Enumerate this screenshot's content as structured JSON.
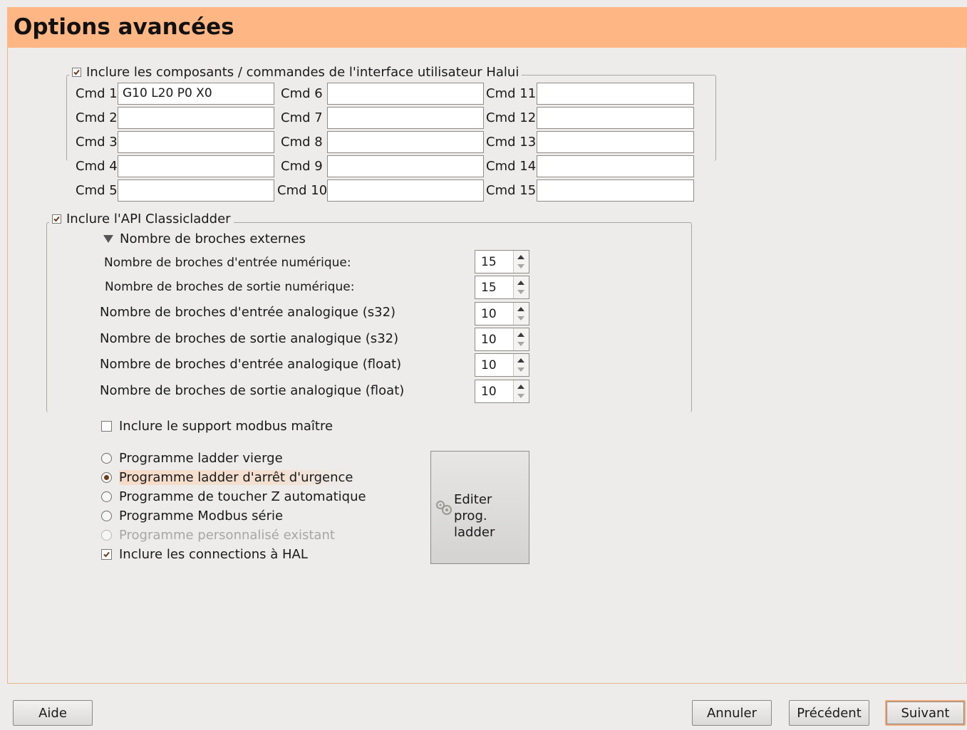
{
  "header": {
    "title": "Options avancées"
  },
  "halui": {
    "checkbox_label": "Inclure les composants / commandes de l'interface utilisateur Halui",
    "checked": true,
    "commands": [
      {
        "label": "Cmd 1",
        "value": "G10 L20 P0 X0"
      },
      {
        "label": "Cmd 2",
        "value": ""
      },
      {
        "label": "Cmd 3",
        "value": ""
      },
      {
        "label": "Cmd 4",
        "value": ""
      },
      {
        "label": "Cmd 5",
        "value": ""
      },
      {
        "label": "Cmd 6",
        "value": ""
      },
      {
        "label": "Cmd 7",
        "value": ""
      },
      {
        "label": "Cmd 8",
        "value": ""
      },
      {
        "label": "Cmd 9",
        "value": ""
      },
      {
        "label": "Cmd 10",
        "value": ""
      },
      {
        "label": "Cmd 11",
        "value": ""
      },
      {
        "label": "Cmd 12",
        "value": ""
      },
      {
        "label": "Cmd 13",
        "value": ""
      },
      {
        "label": "Cmd 14",
        "value": ""
      },
      {
        "label": "Cmd 15",
        "value": ""
      }
    ]
  },
  "classicladder": {
    "checkbox_label": "Inclure l'API Classicladder",
    "checked": true,
    "expander_label": "Nombre de broches externes",
    "pins": [
      {
        "label": "Nombre de broches d'entrée numérique:",
        "value": "15"
      },
      {
        "label": "Nombre de broches de sortie numérique:",
        "value": "15"
      },
      {
        "label": "Nombre de broches d'entrée analogique (s32)",
        "value": "10"
      },
      {
        "label": "Nombre de broches de sortie analogique (s32)",
        "value": "10"
      },
      {
        "label": "Nombre de broches d'entrée analogique (float)",
        "value": "10"
      },
      {
        "label": "Nombre de broches de sortie analogique (float)",
        "value": "10"
      }
    ],
    "modbus_master_label": "Inclure le support modbus maître",
    "modbus_master_checked": false,
    "programs": [
      {
        "label": "Programme ladder vierge",
        "selected": false,
        "disabled": false
      },
      {
        "label": "Programme ladder d'arrêt d'urgence",
        "selected": true,
        "disabled": false
      },
      {
        "label": "Programme de toucher Z automatique",
        "selected": false,
        "disabled": false
      },
      {
        "label": "Programme Modbus série",
        "selected": false,
        "disabled": false
      },
      {
        "label": "Programme personnalisé existant",
        "selected": false,
        "disabled": true
      }
    ],
    "hal_connections_label": "Inclure les connections à HAL",
    "hal_connections_checked": true,
    "edit_button": {
      "line1": "Editer prog.",
      "line2": "ladder",
      "icon": "gears-icon"
    }
  },
  "footer": {
    "help": "Aide",
    "cancel": "Annuler",
    "previous": "Précédent",
    "next": "Suivant"
  },
  "colors": {
    "header_bg": "#ffb685",
    "accent": "#f0a878",
    "window_bg": "#edeceb"
  }
}
